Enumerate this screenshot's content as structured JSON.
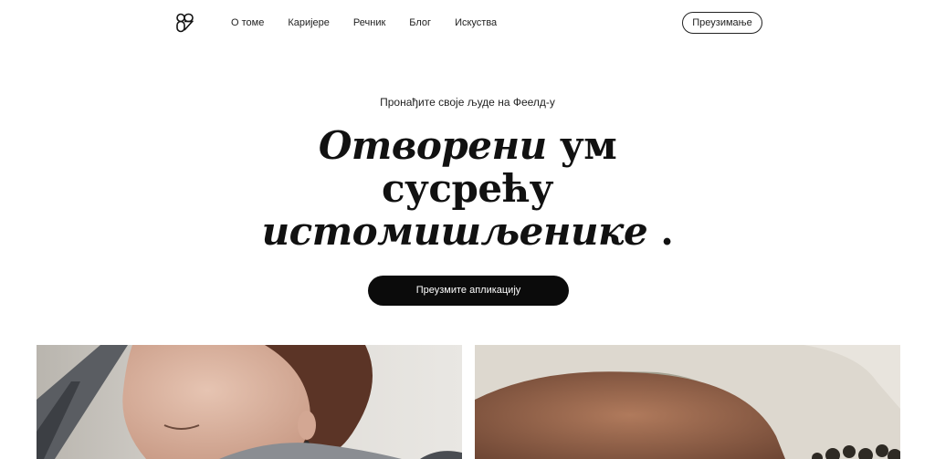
{
  "header": {
    "logo_icon": "feeld-logo-icon",
    "nav": [
      {
        "label": "О томе"
      },
      {
        "label": "Каријере"
      },
      {
        "label": "Речник"
      },
      {
        "label": "Блог"
      },
      {
        "label": "Искуства"
      }
    ],
    "download_label": "Преузимање"
  },
  "hero": {
    "subtitle": "Пронађите своје људе на Феелд-у",
    "headline": {
      "word1": "Отворени",
      "word2": "ум",
      "line2": "сусрећу",
      "line3": "истомишљенике",
      "period": "."
    },
    "cta_label": "Преузмите апликацију"
  },
  "colors": {
    "background": "#ffffff",
    "text": "#111111",
    "cta_background": "#0b0b0b",
    "cta_text": "#ffffff"
  }
}
